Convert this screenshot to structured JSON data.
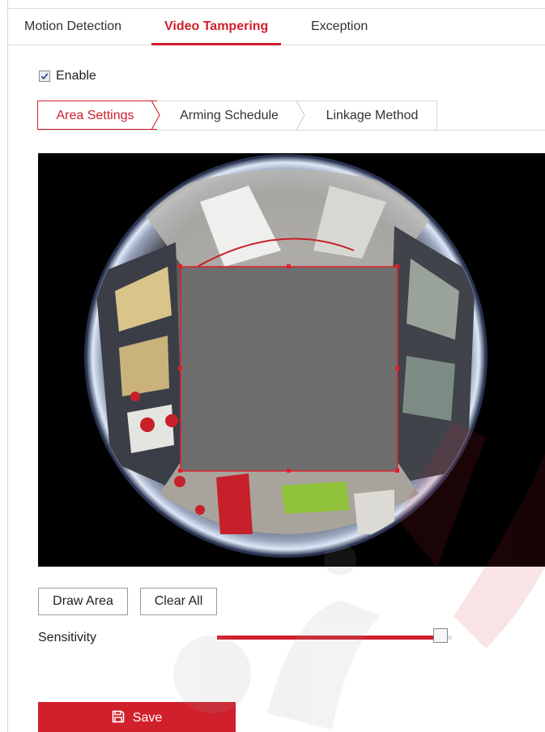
{
  "top_tabs": [
    {
      "label": "Motion Detection",
      "active": false
    },
    {
      "label": "Video Tampering",
      "active": true
    },
    {
      "label": "Exception",
      "active": false
    }
  ],
  "enable": {
    "label": "Enable",
    "checked": true
  },
  "sub_tabs": [
    {
      "label": "Area Settings",
      "active": true
    },
    {
      "label": "Arming Schedule",
      "active": false
    },
    {
      "label": "Linkage Method",
      "active": false
    }
  ],
  "video": {
    "view": "fisheye camera live view",
    "detection_area_color": "#6e6e6e",
    "area_border_color": "#e01e2a"
  },
  "buttons": {
    "draw_area": "Draw Area",
    "clear_all": "Clear All",
    "save": "Save"
  },
  "sensitivity": {
    "label": "Sensitivity",
    "value_fraction": 0.98
  },
  "colors": {
    "accent": "#d0202c",
    "border": "#d6d6d6"
  },
  "icons": {
    "save": "save-icon",
    "checkbox": "checkmark-icon"
  }
}
